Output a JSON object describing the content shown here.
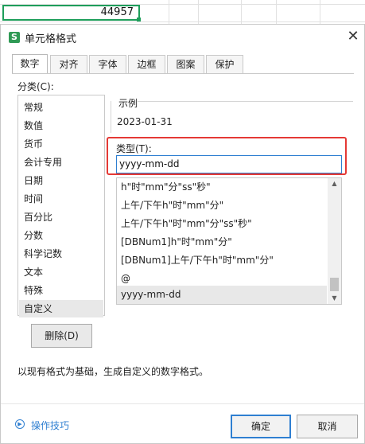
{
  "sheet": {
    "active_cell_value": "44957"
  },
  "dialog": {
    "title": "单元格格式",
    "close_glyph": "✕",
    "tabs": [
      {
        "label": "数字",
        "active": true
      },
      {
        "label": "对齐",
        "active": false
      },
      {
        "label": "字体",
        "active": false
      },
      {
        "label": "边框",
        "active": false
      },
      {
        "label": "图案",
        "active": false
      },
      {
        "label": "保护",
        "active": false
      }
    ],
    "category_label": "分类(C):",
    "categories": [
      "常规",
      "数值",
      "货币",
      "会计专用",
      "日期",
      "时间",
      "百分比",
      "分数",
      "科学记数",
      "文本",
      "特殊",
      "自定义"
    ],
    "selected_category": "自定义",
    "sample_label": "示例",
    "sample_value": "2023-01-31",
    "type_label": "类型(T):",
    "type_value": "yyyy-mm-dd",
    "formats": [
      "h\"时\"mm\"分\"ss\"秒\"",
      "上午/下午h\"时\"mm\"分\"",
      "上午/下午h\"时\"mm\"分\"ss\"秒\"",
      "[DBNum1]h\"时\"mm\"分\"",
      "[DBNum1]上午/下午h\"时\"mm\"分\"",
      "@",
      "yyyy-mm-dd"
    ],
    "delete_button": "删除(D)",
    "description": "以现有格式为基础，生成自定义的数字格式。",
    "tips_link": "操作技巧",
    "ok_button": "确定",
    "cancel_button": "取消"
  },
  "colors": {
    "accent_blue": "#2f7fd1",
    "highlight_red": "#e53935",
    "cell_green": "#1e9e5b"
  }
}
